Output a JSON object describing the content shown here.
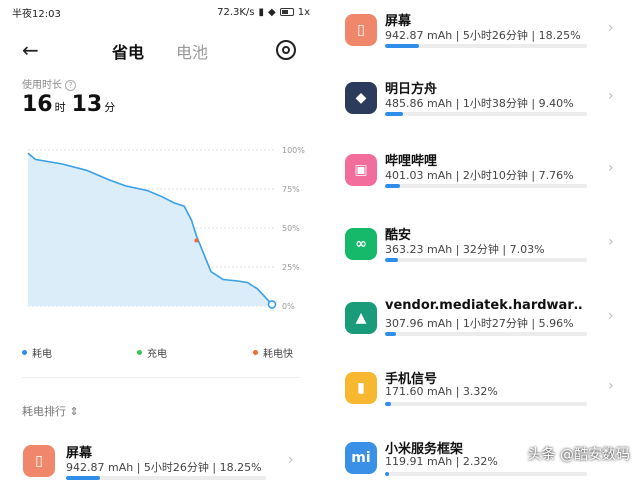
{
  "status_bar": {
    "time": "半夜12:03",
    "net_speed": "72.3K/s",
    "battery_label": "1x"
  },
  "nav": {
    "back_icon": "arrow-left-icon",
    "tabs": [
      {
        "label": "省电",
        "active": true
      },
      {
        "label": "电池",
        "active": false
      }
    ],
    "settings_icon": "gear-icon"
  },
  "usage": {
    "label": "使用时长",
    "hours": "16",
    "hours_unit": "时",
    "minutes": "13",
    "minutes_unit": "分"
  },
  "chart_data": {
    "type": "area",
    "y_ticks": [
      "100%",
      "75%",
      "50%",
      "25%",
      "0%"
    ],
    "ylim": [
      0,
      100
    ],
    "xlim": [
      0,
      100
    ],
    "grid": true,
    "series": [
      {
        "x": [
          0,
          3,
          14,
          24,
          33,
          40,
          49,
          55,
          60,
          64,
          67,
          69,
          75,
          80,
          86,
          90,
          94,
          100
        ],
        "values": [
          98,
          94,
          91,
          87,
          81,
          77,
          74,
          70,
          66,
          64,
          55,
          45,
          22,
          17,
          16,
          15,
          11,
          1
        ]
      }
    ],
    "fast_drain_point": {
      "x": 69,
      "y": 42
    },
    "colors": {
      "line": "#3a9fe8",
      "fill": "#dcedfa",
      "fast": "#f06a35"
    }
  },
  "legend": [
    {
      "label": "耗电",
      "color": "#2f8ee9"
    },
    {
      "label": "充电",
      "color": "#3bbf5b"
    },
    {
      "label": "耗电快",
      "color": "#f06a35"
    }
  ],
  "ranking": {
    "label": "耗电排行 ⇕"
  },
  "left_list": [
    {
      "icon": "screen-icon",
      "color": "#f0876a",
      "name": "屏幕",
      "stats": "942.87 mAh | 5小时26分钟 | 18.25%",
      "percent": 18.25
    }
  ],
  "right_list": [
    {
      "icon": "screen-icon",
      "color": "#f0876a",
      "name": "屏幕",
      "stats": "942.87 mAh | 5小时26分钟 | 18.25%",
      "percent": 18.25
    },
    {
      "icon": "arknights-icon",
      "color": "#2c3a5c",
      "name": "明日方舟",
      "stats": "485.86 mAh | 1小时38分钟 | 9.40%",
      "percent": 9.4
    },
    {
      "icon": "bilibili-icon",
      "color": "#f26d9b",
      "name": "哔哩哔哩",
      "stats": "401.03 mAh | 2小时10分钟 | 7.76%",
      "percent": 7.76
    },
    {
      "icon": "coolapk-icon",
      "color": "#16b86a",
      "name": "酷安",
      "stats": "363.23 mAh | 32分钟 | 7.03%",
      "percent": 7.03
    },
    {
      "icon": "android-icon",
      "color": "#1a9c7a",
      "name": "vendor.mediatek.hardwar‥",
      "stats": "307.96 mAh | 1小时27分钟 | 5.96%",
      "percent": 5.96
    },
    {
      "icon": "signal-icon",
      "color": "#f7b731",
      "name": "手机信号",
      "stats": "171.60 mAh | 3.32%",
      "percent": 3.32
    },
    {
      "icon": "mi-service-icon",
      "color": "#3a8fe6",
      "name": "小米服务框架",
      "stats": "119.91 mAh | 2.32%",
      "percent": 2.32
    }
  ],
  "watermark": "头条 @酷安数码"
}
